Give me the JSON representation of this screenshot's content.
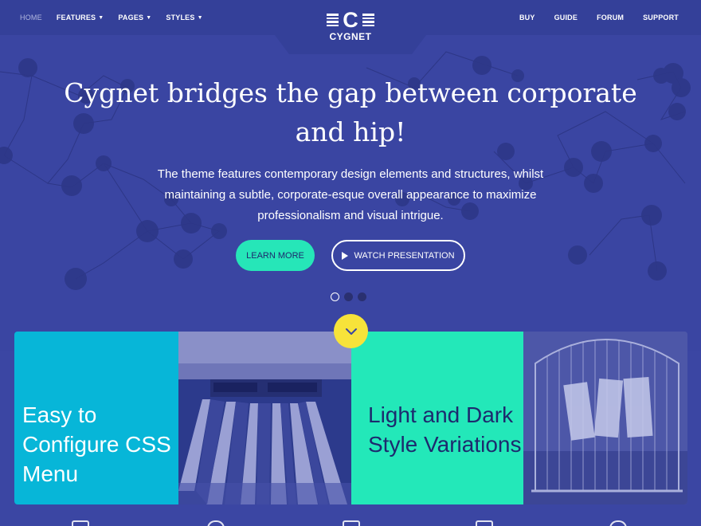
{
  "nav": {
    "left": [
      {
        "label": "HOME",
        "active": true,
        "dropdown": false
      },
      {
        "label": "FEATURES",
        "active": false,
        "dropdown": true
      },
      {
        "label": "PAGES",
        "active": false,
        "dropdown": true
      },
      {
        "label": "STYLES",
        "active": false,
        "dropdown": true
      }
    ],
    "right": [
      {
        "label": "BUY"
      },
      {
        "label": "GUIDE"
      },
      {
        "label": "FORUM"
      },
      {
        "label": "SUPPORT"
      }
    ],
    "caret_icon": "chevron-down-icon"
  },
  "logo": {
    "letter": "C",
    "name": "CYGNET"
  },
  "hero": {
    "title": "Cygnet bridges the gap between corporate and hip!",
    "subtitle": "The theme features contemporary design elements and structures, whilst maintaining a subtle, corporate-esque overall appearance to maximize professionalism and visual intrigue.",
    "learn_more": "LEARN MORE",
    "watch": "WATCH PRESENTATION",
    "slides_total": 3,
    "slide_active": 1
  },
  "tiles": [
    {
      "type": "text",
      "text": "Easy to Configure CSS Menu",
      "bg": "#07b6d8"
    },
    {
      "type": "image",
      "icon": "escalator-photo",
      "bg": "#2c3a8c"
    },
    {
      "type": "text",
      "text": "Light and Dark Style Variations",
      "bg": "#23e8b9"
    },
    {
      "type": "image",
      "icon": "birdcage-photo",
      "bg": "#5a63ad"
    }
  ],
  "colors": {
    "primary": "#3a45a2",
    "accent_mint": "#26e6b8",
    "accent_cyan": "#07b6d8",
    "accent_yellow": "#f7e33a",
    "text_dark": "#1d2a6e"
  }
}
